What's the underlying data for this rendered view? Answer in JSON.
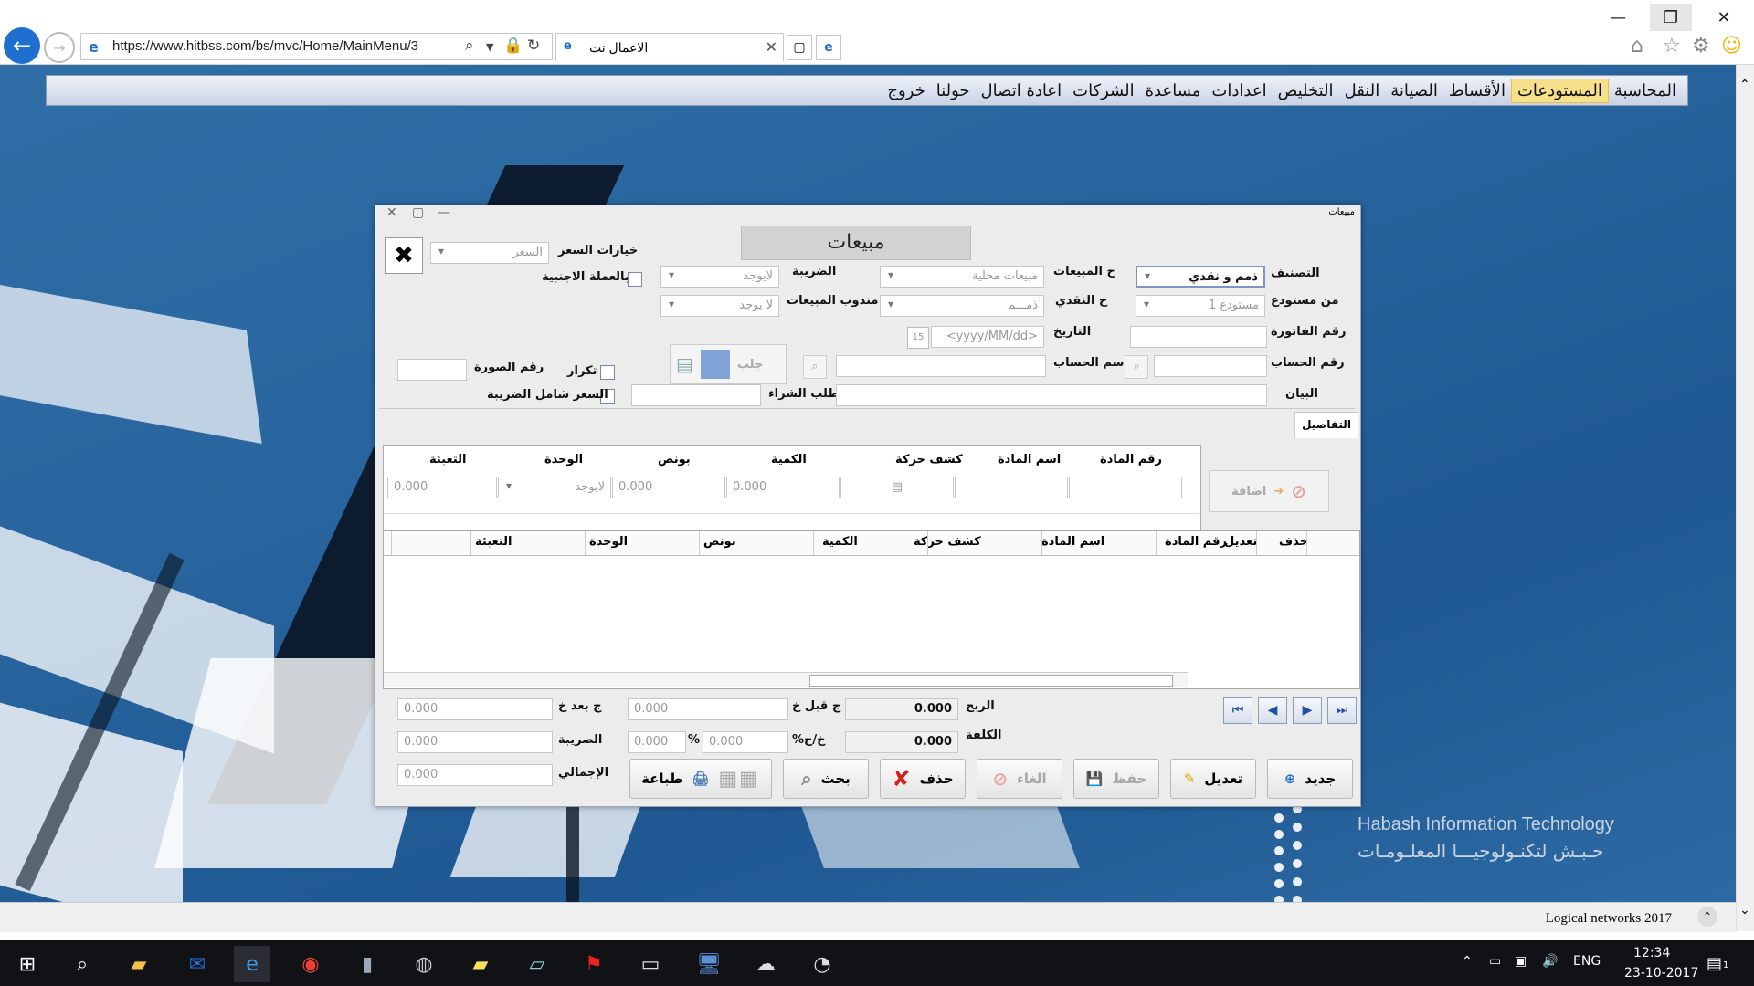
{
  "browser": {
    "url": "https://www.hitbss.com/bs/mvc/Home/MainMenu/3",
    "tab_title": "الاعمال نت"
  },
  "menu": {
    "items": [
      "المحاسبة",
      "المستودعات",
      "الأقساط",
      "الصيانة",
      "النقل",
      "التخليص",
      "اعدادات",
      "مساعدة",
      "الشركات",
      "اعادة اتصال",
      "حولنا",
      "خروج"
    ],
    "active": "المستودعات"
  },
  "dialog": {
    "caption": "مبيعات",
    "title": "مبيعات",
    "fields": {
      "classification_label": "التصنيف",
      "classification_value": "ذمم و نقدي",
      "from_warehouse_label": "من مستودع",
      "from_warehouse_value": "مستودع 1",
      "sales_account_label": "ح المبيعات",
      "sales_account_value": "مبيعات محلية",
      "cash_account_label": "ح النقدي",
      "cash_account_value": "ذمـــم",
      "tax_label": "الضريبة",
      "tax_value": "لايوجد",
      "sales_rep_label": "مندوب المبيعات",
      "sales_rep_value": "لا يوجد",
      "price_options_label": "خيارات السعر",
      "price_options_placeholder": "السعر",
      "foreign_currency_label": "بالعملة الاجنبية",
      "invoice_no_label": "رقم الفاتورة",
      "date_label": "التاريخ",
      "date_placeholder": "<yyyy/MM/dd>",
      "account_no_label": "رقم الحساب",
      "account_name_label": "اسم الحساب",
      "fetch_label": "جلب",
      "repeat_label": "تكرار",
      "image_no_label": "رقم الصورة",
      "statement_label": "البيان",
      "purchase_request_label": "طلب الشراء",
      "price_incl_tax_label": "السعر شامل الضريبة"
    },
    "details_tab": "التفاصيل",
    "entry_headers": [
      "رقم المادة",
      "اسم المادة",
      "كشف حركة",
      "الكمية",
      "بونص",
      "الوحدة",
      "التعبئة"
    ],
    "entry_values": {
      "quantity": "0.000",
      "bonus": "0.000",
      "unit": "لايوجد",
      "packing": "0.000"
    },
    "add_label": "اضافة",
    "grid_headers": [
      "حذف",
      "تعديل",
      "رقم المادة",
      "اسم المادة",
      "كشف حركة",
      "الكمية",
      "بونص",
      "الوحدة",
      "التعبئة"
    ],
    "totals": {
      "profit_label": "الربح",
      "profit_value": "0.000",
      "cost_label": "الكلفة",
      "cost_value": "0.000",
      "before_disc_label": "ج قبل خ",
      "before_disc_value": "0.000",
      "disc_label": "خ/خ%",
      "disc_value": "0.000",
      "disc_pct": "0.000",
      "pct_sign": "%",
      "after_disc_label": "ج بعد خ",
      "after_disc_value": "0.000",
      "tax_label": "الضريبة",
      "tax_value": "0.000",
      "total_label": "الإجمالي",
      "total_value": "0.000"
    },
    "buttons": {
      "new": "جديد",
      "edit": "تعديل",
      "save": "حفظ",
      "cancel": "الغاء",
      "delete": "حذف",
      "search": "بحث",
      "print": "طباعة"
    }
  },
  "branding": {
    "company_en": "Habash Information Technology",
    "company_ar": "حـبـش لتكنـولوجيـــا المعلـومـات"
  },
  "status_bar": {
    "text": "Logical networks 2017"
  },
  "taskbar": {
    "lang": "ENG",
    "time": "12:34",
    "date": "23-10-2017",
    "notifications": "1"
  },
  "colors": {
    "accent": "#1f6fd1",
    "menu_active": "#f6e08a",
    "page_bg": "#2a67a0",
    "taskbar": "#101215"
  }
}
